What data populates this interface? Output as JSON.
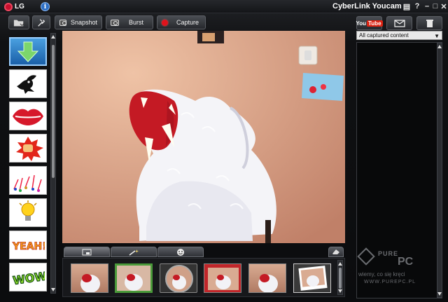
{
  "window": {
    "brand": "LG",
    "title": "CyberLink Youcam",
    "controls": [
      "menu-icon",
      "help-icon",
      "minimize-icon",
      "maximize-icon",
      "close-icon"
    ]
  },
  "toolbar": {
    "snapshot_label": "Snapshot",
    "burst_label": "Burst",
    "capture_label": "Capture"
  },
  "effects": [
    {
      "name": "download-effects"
    },
    {
      "name": "bird-silhouette"
    },
    {
      "name": "red-lips"
    },
    {
      "name": "punch-comic"
    },
    {
      "name": "music-notes"
    },
    {
      "name": "light-bulb"
    },
    {
      "name": "yeah-text"
    },
    {
      "name": "wow-text"
    }
  ],
  "bottom_tabs": [
    "frame-tab",
    "magic-wand-tab",
    "emotion-tab"
  ],
  "right_panel": {
    "youtube_label": "You",
    "youtube_tube": "Tube",
    "filter": {
      "selected": "All captured content"
    }
  },
  "watermark": {
    "brand_left": "PURE",
    "brand_right": "PC",
    "slogan": "wiemy, co się kręci",
    "url": "WWW.PUREPC.PL"
  },
  "colors": {
    "capture_red": "#e0121b",
    "youtube_red": "#d21",
    "accent": "#4aa0e0"
  }
}
